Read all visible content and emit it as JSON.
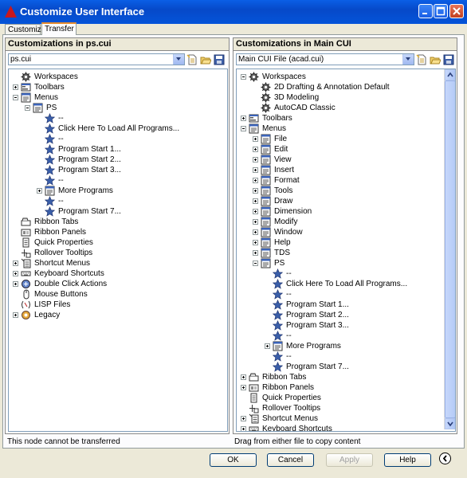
{
  "window": {
    "title": "Customize User Interface"
  },
  "tabs": [
    {
      "label": "Customize"
    },
    {
      "label": "Transfer"
    }
  ],
  "left": {
    "header": "Customizations in ps.cui",
    "file_combo": "ps.cui",
    "status": "This node cannot be transferred",
    "tree": [
      {
        "label": "Workspaces",
        "icon": "gear-icon"
      },
      {
        "label": "Toolbars",
        "icon": "toolbar-icon"
      },
      {
        "label": "Menus",
        "icon": "menu-icon"
      },
      {
        "label": "PS",
        "icon": "menu-icon"
      },
      {
        "label": "--",
        "icon": "star-icon"
      },
      {
        "label": "Click Here To Load All Programs...",
        "icon": "star-icon"
      },
      {
        "label": "--",
        "icon": "star-icon"
      },
      {
        "label": "Program Start 1...",
        "icon": "star-icon"
      },
      {
        "label": "Program Start 2...",
        "icon": "star-icon"
      },
      {
        "label": "Program Start 3...",
        "icon": "star-icon"
      },
      {
        "label": "--",
        "icon": "star-icon"
      },
      {
        "label": "More Programs",
        "icon": "menu-icon"
      },
      {
        "label": "--",
        "icon": "star-icon"
      },
      {
        "label": "Program Start 7...",
        "icon": "star-icon"
      },
      {
        "label": "Ribbon Tabs",
        "icon": "ribbon-tab-icon"
      },
      {
        "label": "Ribbon Panels",
        "icon": "ribbon-panel-icon"
      },
      {
        "label": "Quick Properties",
        "icon": "quick-properties-icon"
      },
      {
        "label": "Rollover Tooltips",
        "icon": "rollover-icon"
      },
      {
        "label": "Shortcut Menus",
        "icon": "shortcut-menu-icon"
      },
      {
        "label": "Keyboard Shortcuts",
        "icon": "keyboard-icon"
      },
      {
        "label": "Double Click Actions",
        "icon": "double-click-icon"
      },
      {
        "label": "Mouse Buttons",
        "icon": "mouse-icon"
      },
      {
        "label": "LISP Files",
        "icon": "lisp-icon"
      },
      {
        "label": "Legacy",
        "icon": "legacy-icon"
      }
    ]
  },
  "right": {
    "header": "Customizations in Main CUI",
    "file_combo": "Main CUI File (acad.cui)",
    "status": "Drag from either file to copy content",
    "tree": [
      {
        "label": "Workspaces",
        "icon": "gear-icon"
      },
      {
        "label": "2D Drafting & Annotation Default",
        "icon": "gear-icon"
      },
      {
        "label": "3D Modeling",
        "icon": "gear-icon"
      },
      {
        "label": "AutoCAD Classic",
        "icon": "gear-icon"
      },
      {
        "label": "Toolbars",
        "icon": "toolbar-icon"
      },
      {
        "label": "Menus",
        "icon": "menu-icon"
      },
      {
        "label": "File",
        "icon": "menu-icon"
      },
      {
        "label": "Edit",
        "icon": "menu-icon"
      },
      {
        "label": "View",
        "icon": "menu-icon"
      },
      {
        "label": "Insert",
        "icon": "menu-icon"
      },
      {
        "label": "Format",
        "icon": "menu-icon"
      },
      {
        "label": "Tools",
        "icon": "menu-icon"
      },
      {
        "label": "Draw",
        "icon": "menu-icon"
      },
      {
        "label": "Dimension",
        "icon": "menu-icon"
      },
      {
        "label": "Modify",
        "icon": "menu-icon"
      },
      {
        "label": "Window",
        "icon": "menu-icon"
      },
      {
        "label": "Help",
        "icon": "menu-icon"
      },
      {
        "label": "TDS",
        "icon": "menu-icon"
      },
      {
        "label": "PS",
        "icon": "menu-icon"
      },
      {
        "label": "--",
        "icon": "star-icon"
      },
      {
        "label": "Click Here To Load All Programs...",
        "icon": "star-icon"
      },
      {
        "label": "--",
        "icon": "star-icon"
      },
      {
        "label": "Program Start 1...",
        "icon": "star-icon"
      },
      {
        "label": "Program Start 2...",
        "icon": "star-icon"
      },
      {
        "label": "Program Start 3...",
        "icon": "star-icon"
      },
      {
        "label": "--",
        "icon": "star-icon"
      },
      {
        "label": "More Programs",
        "icon": "menu-icon"
      },
      {
        "label": "--",
        "icon": "star-icon"
      },
      {
        "label": "Program Start 7...",
        "icon": "star-icon"
      },
      {
        "label": "Ribbon Tabs",
        "icon": "ribbon-tab-icon"
      },
      {
        "label": "Ribbon Panels",
        "icon": "ribbon-panel-icon"
      },
      {
        "label": "Quick Properties",
        "icon": "quick-properties-icon"
      },
      {
        "label": "Rollover Tooltips",
        "icon": "rollover-icon"
      },
      {
        "label": "Shortcut Menus",
        "icon": "shortcut-menu-icon"
      },
      {
        "label": "Keyboard Shortcuts",
        "icon": "keyboard-icon"
      }
    ]
  },
  "buttons": {
    "ok": "OK",
    "cancel": "Cancel",
    "apply": "Apply",
    "help": "Help"
  }
}
